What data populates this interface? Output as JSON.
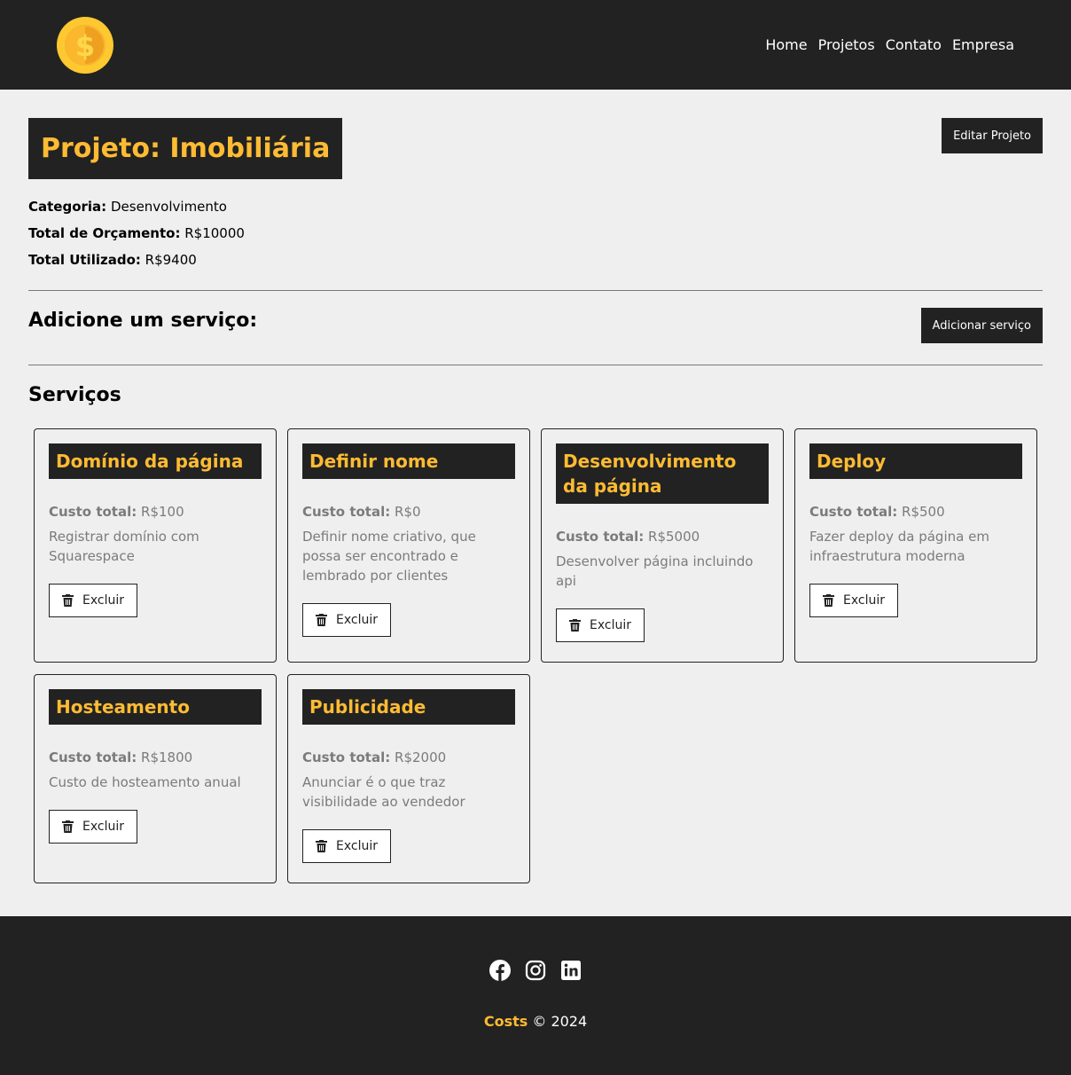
{
  "nav": {
    "links": [
      "Home",
      "Projetos",
      "Contato",
      "Empresa"
    ]
  },
  "project": {
    "title": "Projeto: Imobiliária",
    "edit_label": "Editar Projeto",
    "category_label": "Categoria:",
    "category": "Desenvolvimento",
    "budget_label": "Total de Orçamento:",
    "budget": "R$10000",
    "used_label": "Total Utilizado:",
    "used": "R$9400"
  },
  "add_service": {
    "title": "Adicione um serviço:",
    "button_label": "Adicionar serviço"
  },
  "services": {
    "title": "Serviços",
    "cost_label": "Custo total:",
    "delete_label": "Excluir",
    "items": [
      {
        "name": "Domínio da página",
        "cost": "R$100",
        "description": "Registrar domínio com Squarespace"
      },
      {
        "name": "Definir nome",
        "cost": "R$0",
        "description": "Definir nome criativo, que possa ser encontrado e lembrado por clientes"
      },
      {
        "name": "Desenvolvimento da página",
        "cost": "R$5000",
        "description": "Desenvolver página incluindo api"
      },
      {
        "name": "Deploy",
        "cost": "R$500",
        "description": "Fazer deploy da página em infraestrutura moderna"
      },
      {
        "name": "Hosteamento",
        "cost": "R$1800",
        "description": "Custo de hosteamento anual"
      },
      {
        "name": "Publicidade",
        "cost": "R$2000",
        "description": "Anunciar é o que traz visibilidade ao vendedor"
      }
    ]
  },
  "footer": {
    "icons": [
      "facebook-icon",
      "instagram-icon",
      "linkedin-icon"
    ],
    "brand": "Costs",
    "copyright": " © 2024"
  },
  "colors": {
    "dark": "#222222",
    "accent": "#ffbb33",
    "background": "#efefef"
  }
}
